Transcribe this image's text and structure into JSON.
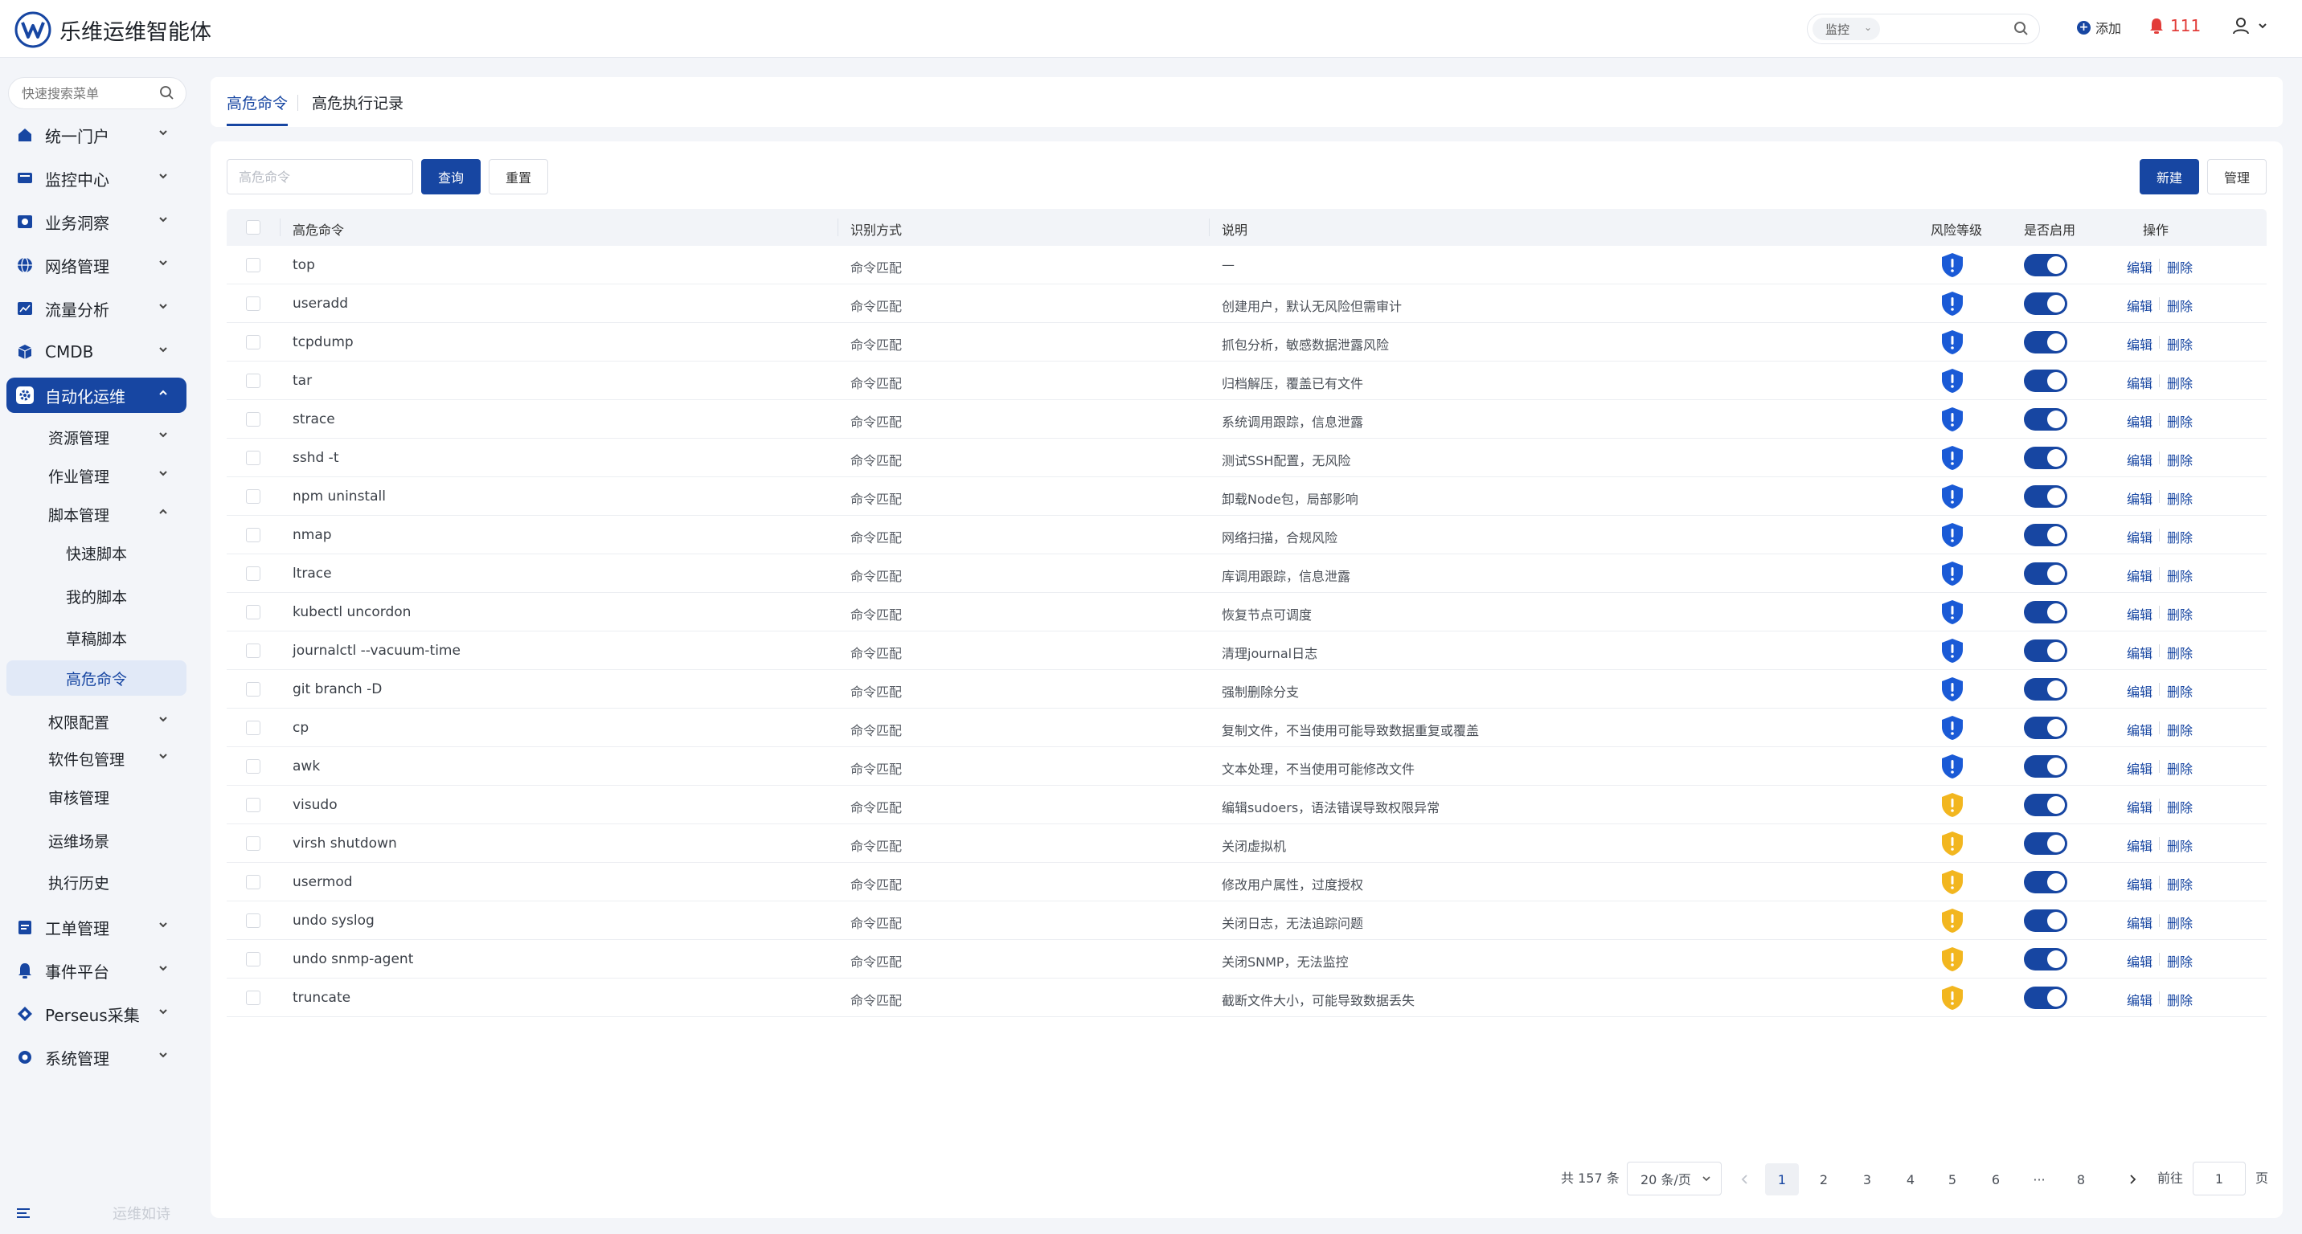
{
  "app": {
    "title": "乐维运维智能体"
  },
  "header": {
    "search_scope": "监控",
    "add_label": "添加",
    "alarm_count": "111"
  },
  "sidebar": {
    "search_placeholder": "快速搜索菜单",
    "items": [
      {
        "label": "统一门户",
        "icon": "portal-icon"
      },
      {
        "label": "监控中心",
        "icon": "monitor-icon"
      },
      {
        "label": "业务洞察",
        "icon": "insight-icon"
      },
      {
        "label": "网络管理",
        "icon": "globe-icon"
      },
      {
        "label": "流量分析",
        "icon": "traffic-icon"
      },
      {
        "label": "CMDB",
        "icon": "cube-icon"
      },
      {
        "label": "自动化运维",
        "icon": "automation-gear-icon"
      }
    ],
    "auto_children": [
      {
        "label": "资源管理"
      },
      {
        "label": "作业管理"
      },
      {
        "label": "脚本管理"
      }
    ],
    "script_children": [
      {
        "label": "快速脚本"
      },
      {
        "label": "我的脚本"
      },
      {
        "label": "草稿脚本"
      },
      {
        "label": "高危命令"
      }
    ],
    "auto_children_2": [
      {
        "label": "权限配置"
      },
      {
        "label": "软件包管理"
      },
      {
        "label": "审核管理"
      },
      {
        "label": "运维场景"
      },
      {
        "label": "执行历史"
      }
    ],
    "items_bottom": [
      {
        "label": "工单管理",
        "icon": "ticket-icon"
      },
      {
        "label": "事件平台",
        "icon": "bell-icon"
      },
      {
        "label": "Perseus采集",
        "icon": "diamond-icon"
      },
      {
        "label": "系统管理",
        "icon": "settings-icon"
      }
    ],
    "footer_slogan": "运维如诗"
  },
  "tabs": [
    {
      "label": "高危命令"
    },
    {
      "label": "高危执行记录"
    }
  ],
  "filters": {
    "command_placeholder": "高危命令",
    "query_label": "查询",
    "reset_label": "重置",
    "new_label": "新建",
    "manage_label": "管理"
  },
  "table": {
    "columns": [
      "高危命令",
      "识别方式",
      "说明",
      "风险等级",
      "是否启用",
      "操作"
    ],
    "edit_label": "编辑",
    "delete_label": "删除",
    "colors": {
      "high_risk": "#1a5ad6",
      "medium_risk": "#f2b61f",
      "toggle_on": "#1746a2"
    },
    "rows": [
      {
        "command": "top",
        "mode": "命令匹配",
        "desc": "—",
        "risk": "high",
        "enabled": true
      },
      {
        "command": "useradd",
        "mode": "命令匹配",
        "desc": "创建用户，默认无风险但需审计",
        "risk": "high",
        "enabled": true
      },
      {
        "command": "tcpdump",
        "mode": "命令匹配",
        "desc": "抓包分析，敏感数据泄露风险",
        "risk": "high",
        "enabled": true
      },
      {
        "command": "tar",
        "mode": "命令匹配",
        "desc": "归档解压，覆盖已有文件",
        "risk": "high",
        "enabled": true
      },
      {
        "command": "strace",
        "mode": "命令匹配",
        "desc": "系统调用跟踪，信息泄露",
        "risk": "high",
        "enabled": true
      },
      {
        "command": "sshd -t",
        "mode": "命令匹配",
        "desc": "测试SSH配置，无风险",
        "risk": "high",
        "enabled": true
      },
      {
        "command": "npm uninstall",
        "mode": "命令匹配",
        "desc": "卸载Node包，局部影响",
        "risk": "high",
        "enabled": true
      },
      {
        "command": "nmap",
        "mode": "命令匹配",
        "desc": "网络扫描，合规风险",
        "risk": "high",
        "enabled": true
      },
      {
        "command": "ltrace",
        "mode": "命令匹配",
        "desc": "库调用跟踪，信息泄露",
        "risk": "high",
        "enabled": true
      },
      {
        "command": "kubectl uncordon",
        "mode": "命令匹配",
        "desc": "恢复节点可调度",
        "risk": "high",
        "enabled": true
      },
      {
        "command": "journalctl --vacuum-time",
        "mode": "命令匹配",
        "desc": "清理journal日志",
        "risk": "high",
        "enabled": true
      },
      {
        "command": "git branch -D",
        "mode": "命令匹配",
        "desc": "强制删除分支",
        "risk": "high",
        "enabled": true
      },
      {
        "command": "cp",
        "mode": "命令匹配",
        "desc": "复制文件，不当使用可能导致数据重复或覆盖",
        "risk": "high",
        "enabled": true
      },
      {
        "command": "awk",
        "mode": "命令匹配",
        "desc": "文本处理，不当使用可能修改文件",
        "risk": "high",
        "enabled": true
      },
      {
        "command": "visudo",
        "mode": "命令匹配",
        "desc": "编辑sudoers，语法错误导致权限异常",
        "risk": "medium",
        "enabled": true
      },
      {
        "command": "virsh shutdown",
        "mode": "命令匹配",
        "desc": "关闭虚拟机",
        "risk": "medium",
        "enabled": true
      },
      {
        "command": "usermod",
        "mode": "命令匹配",
        "desc": "修改用户属性，过度授权",
        "risk": "medium",
        "enabled": true
      },
      {
        "command": "undo syslog",
        "mode": "命令匹配",
        "desc": "关闭日志，无法追踪问题",
        "risk": "medium",
        "enabled": true
      },
      {
        "command": "undo snmp-agent",
        "mode": "命令匹配",
        "desc": "关闭SNMP，无法监控",
        "risk": "medium",
        "enabled": true
      },
      {
        "command": "truncate",
        "mode": "命令匹配",
        "desc": "截断文件大小，可能导致数据丢失",
        "risk": "medium",
        "enabled": true
      }
    ]
  },
  "pagination": {
    "total_label": "共 157 条",
    "page_size": "20 条/页",
    "pages": [
      "1",
      "2",
      "3",
      "4",
      "5",
      "6",
      "···",
      "8"
    ],
    "current_page": "1",
    "goto_label": "前往",
    "goto_value": "1",
    "page_suffix": "页"
  }
}
